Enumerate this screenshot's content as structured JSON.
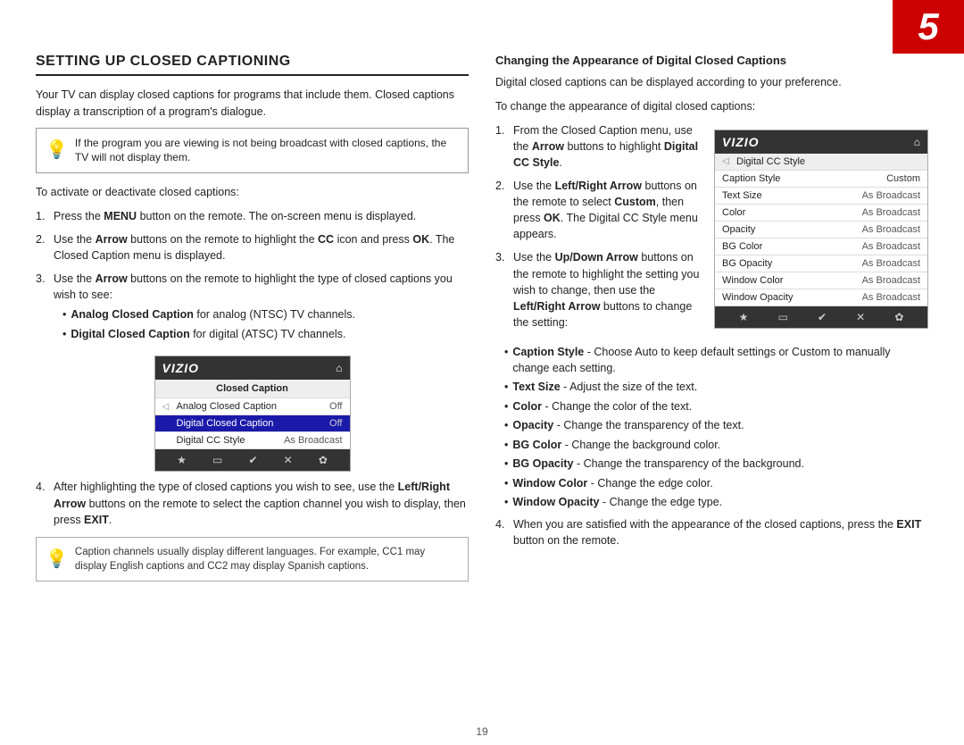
{
  "page": {
    "number": "5",
    "page_label": "19"
  },
  "left": {
    "heading": "SETTING UP CLOSED CAPTIONING",
    "intro": "Your TV can display closed captions for programs that include them. Closed captions display a transcription of a program's dialogue.",
    "info_box": "If the program you are viewing is not being broadcast with closed captions, the TV will not display them.",
    "activate_text": "To activate or deactivate closed captions:",
    "steps": [
      {
        "num": "1.",
        "text": "Press the ",
        "bold": "MENU",
        "rest": " button on the remote. The on-screen menu is displayed."
      },
      {
        "num": "2.",
        "text": "Use the ",
        "bold": "Arrow",
        "rest": " buttons on the remote to highlight the CC icon and press ",
        "bold2": "OK",
        "rest2": ". The Closed Caption menu is displayed."
      },
      {
        "num": "3.",
        "text": "Use the ",
        "bold": "Arrow",
        "rest": " buttons on the remote to highlight the type of closed captions you wish to see:"
      },
      {
        "num": "4.",
        "text": "After highlighting the type of closed captions you wish to see, use the ",
        "bold": "Left/Right Arrow",
        "rest": " buttons on the remote to select the caption channel you wish to display, then press ",
        "bold2": "EXIT",
        "rest2": "."
      }
    ],
    "step3_bullets": [
      {
        "bold": "Analog Closed Caption",
        "rest": " for analog (NTSC) TV channels."
      },
      {
        "bold": "Digital Closed Caption",
        "rest": " for digital (ATSC) TV channels."
      }
    ],
    "note_box": "Caption channels usually display different languages. For example, CC1 may display English captions and CC2 may display Spanish captions."
  },
  "tv_left": {
    "logo": "VIZIO",
    "title": "Closed Caption",
    "rows": [
      {
        "label": "Analog Closed Caption",
        "value": "Off",
        "highlighted": false
      },
      {
        "label": "Digital Closed Caption",
        "value": "Off",
        "highlighted": true
      },
      {
        "label": "Digital CC Style",
        "value": "As Broadcast",
        "highlighted": false
      }
    ],
    "footer_icons": [
      "★",
      "□",
      "✔",
      "✕",
      "✿"
    ]
  },
  "right": {
    "heading": "Changing the Appearance of Digital Closed Captions",
    "intro1": "Digital closed captions can be displayed according to your preference.",
    "intro2": "To change the appearance of digital closed captions:",
    "steps": [
      {
        "num": "1.",
        "text": "From the Closed Caption menu, use the ",
        "bold": "Arrow",
        "rest": " buttons to highlight ",
        "bold2": "Digital CC Style",
        "rest2": "."
      },
      {
        "num": "2.",
        "text": "Use the ",
        "bold": "Left/Right Arrow",
        "rest": " buttons on the remote to select ",
        "bold2": "Custom",
        "rest2": ", then press ",
        "bold3": "OK",
        "rest3": ". The Digital CC Style menu appears."
      },
      {
        "num": "3.",
        "text": "Use the ",
        "bold": "Up/Down Arrow",
        "rest": " buttons on the remote to highlight the setting you wish to change, then use the ",
        "bold2": "Left/Right Arrow",
        "rest2": " buttons to change the setting:"
      },
      {
        "num": "4.",
        "text": "When you are satisfied with the appearance of the closed captions, press the ",
        "bold": "EXIT",
        "rest": " button on the remote."
      }
    ],
    "step3_bullets": [
      {
        "bold": "Caption Style",
        "rest": " - Choose Auto to keep default settings or Custom to manually change each setting."
      },
      {
        "bold": "Text Size",
        "rest": " - Adjust the size of the text."
      },
      {
        "bold": "Color",
        "rest": " - Change the color of the text."
      },
      {
        "bold": "Opacity",
        "rest": " - Change the transparency of the text."
      },
      {
        "bold": "BG Color",
        "rest": " - Change the background color."
      },
      {
        "bold": "BG Opacity",
        "rest": " - Change the transparency of the background."
      },
      {
        "bold": "Window Color",
        "rest": " - Change the edge color."
      },
      {
        "bold": "Window Opacity",
        "rest": " - Change the edge type."
      }
    ]
  },
  "tv_right": {
    "logo": "VIZIO",
    "section": "Digital CC Style",
    "rows": [
      {
        "label": "Caption Style",
        "value": "Custom"
      },
      {
        "label": "Text Size",
        "value": "As Broadcast"
      },
      {
        "label": "Color",
        "value": "As Broadcast"
      },
      {
        "label": "Opacity",
        "value": "As Broadcast"
      },
      {
        "label": "BG Color",
        "value": "As Broadcast"
      },
      {
        "label": "BG Opacity",
        "value": "As Broadcast"
      },
      {
        "label": "Window Color",
        "value": "As Broadcast"
      },
      {
        "label": "Window Opacity",
        "value": "As Broadcast"
      }
    ],
    "footer_icons": [
      "★",
      "□",
      "✔",
      "✕",
      "✿"
    ]
  }
}
